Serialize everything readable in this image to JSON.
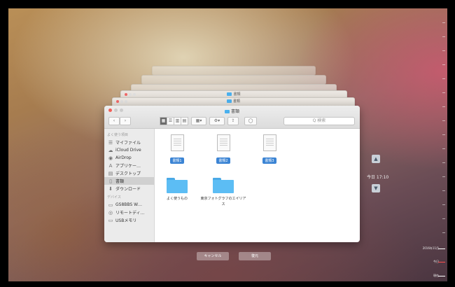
{
  "stacked_windows": [
    {
      "title": ""
    },
    {
      "title": ""
    },
    {
      "title": ""
    },
    {
      "title": "書類"
    },
    {
      "title": "書類"
    }
  ],
  "finder": {
    "title": "書類",
    "toolbar": {
      "back": "‹",
      "forward": "›",
      "view_icon": "▦",
      "view_list": "☰",
      "view_columns": "▥",
      "view_cover": "▤",
      "arrange": "▦▾",
      "action": "⚙▾",
      "share": "⇪",
      "tags": "◯",
      "search_placeholder": "Q 検索"
    },
    "sidebar": {
      "favorites_header": "よく使う項目",
      "favorites": [
        {
          "label": "マイファイル",
          "icon": "☰"
        },
        {
          "label": "iCloud Drive",
          "icon": "☁"
        },
        {
          "label": "AirDrop",
          "icon": "◉"
        },
        {
          "label": "アプリケー…",
          "icon": "A"
        },
        {
          "label": "デスクトップ",
          "icon": "▤"
        },
        {
          "label": "書類",
          "icon": "▯",
          "selected": true
        },
        {
          "label": "ダウンロード",
          "icon": "⬇"
        }
      ],
      "devices_header": "デバイス",
      "devices": [
        {
          "label": "GS8BBS W…",
          "icon": "▭"
        },
        {
          "label": "リモートディ…",
          "icon": "◎"
        },
        {
          "label": "USBメモリ",
          "icon": "▭"
        }
      ]
    },
    "items": [
      {
        "type": "doc",
        "label": "書類1"
      },
      {
        "type": "doc",
        "label": "書類2"
      },
      {
        "type": "doc",
        "label": "書類3"
      },
      {
        "type": "folder",
        "label": "よく使うもの"
      },
      {
        "type": "folder",
        "label": "東京フォトグラフのエイリアス"
      }
    ]
  },
  "time_machine": {
    "up_arrow": "▲",
    "down_arrow": "▼",
    "current_time": "今日 17:10",
    "cancel_label": "キャンセル",
    "restore_label": "復元",
    "timeline_labels": [
      "2016年11月",
      "今日",
      "現在"
    ]
  },
  "colors": {
    "selection_tag": "#3b84d4",
    "folder": "#5cbdf4",
    "close_button": "#f25f58"
  }
}
